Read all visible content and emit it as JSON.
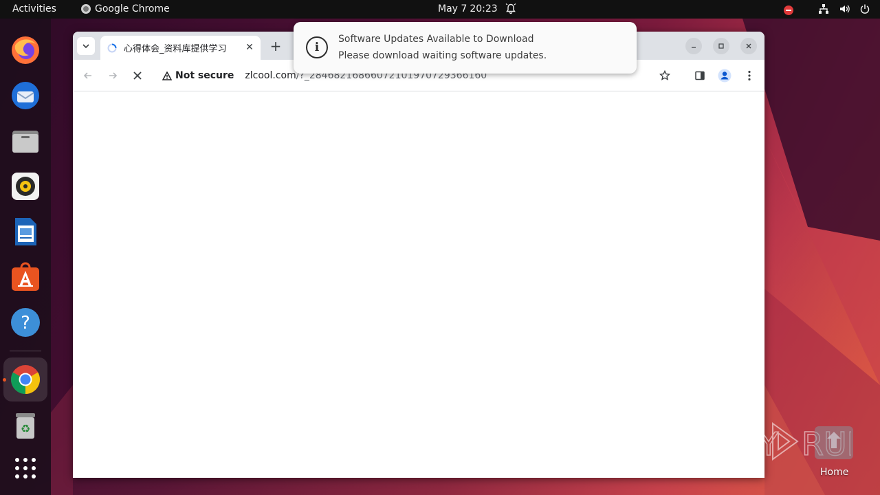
{
  "topbar": {
    "activities": "Activities",
    "app_name": "Google Chrome",
    "date": "May 7",
    "time": "20:23"
  },
  "dock": {
    "items": [
      "firefox-icon",
      "thunderbird-icon",
      "files-icon",
      "rhythmbox-icon",
      "libreoffice-writer-icon",
      "app-center-icon",
      "help-icon",
      "chrome-icon",
      "trash-icon",
      "show-apps-icon"
    ],
    "active": "chrome-icon"
  },
  "browser": {
    "tab_title": "心得体会_资料库提供学习",
    "security_label": "Not secure",
    "url_host": "zlcool.com",
    "url_path": "/?_284682168660721019707293661​60"
  },
  "notification": {
    "title": "Software Updates Available to Download",
    "body": "Please download waiting software updates."
  },
  "desktop": {
    "home_label": "Home",
    "watermark": "ANY RUN"
  },
  "colors": {
    "accent": "#e95420",
    "topbar": "#111111",
    "tabstrip": "#dee1e6"
  }
}
